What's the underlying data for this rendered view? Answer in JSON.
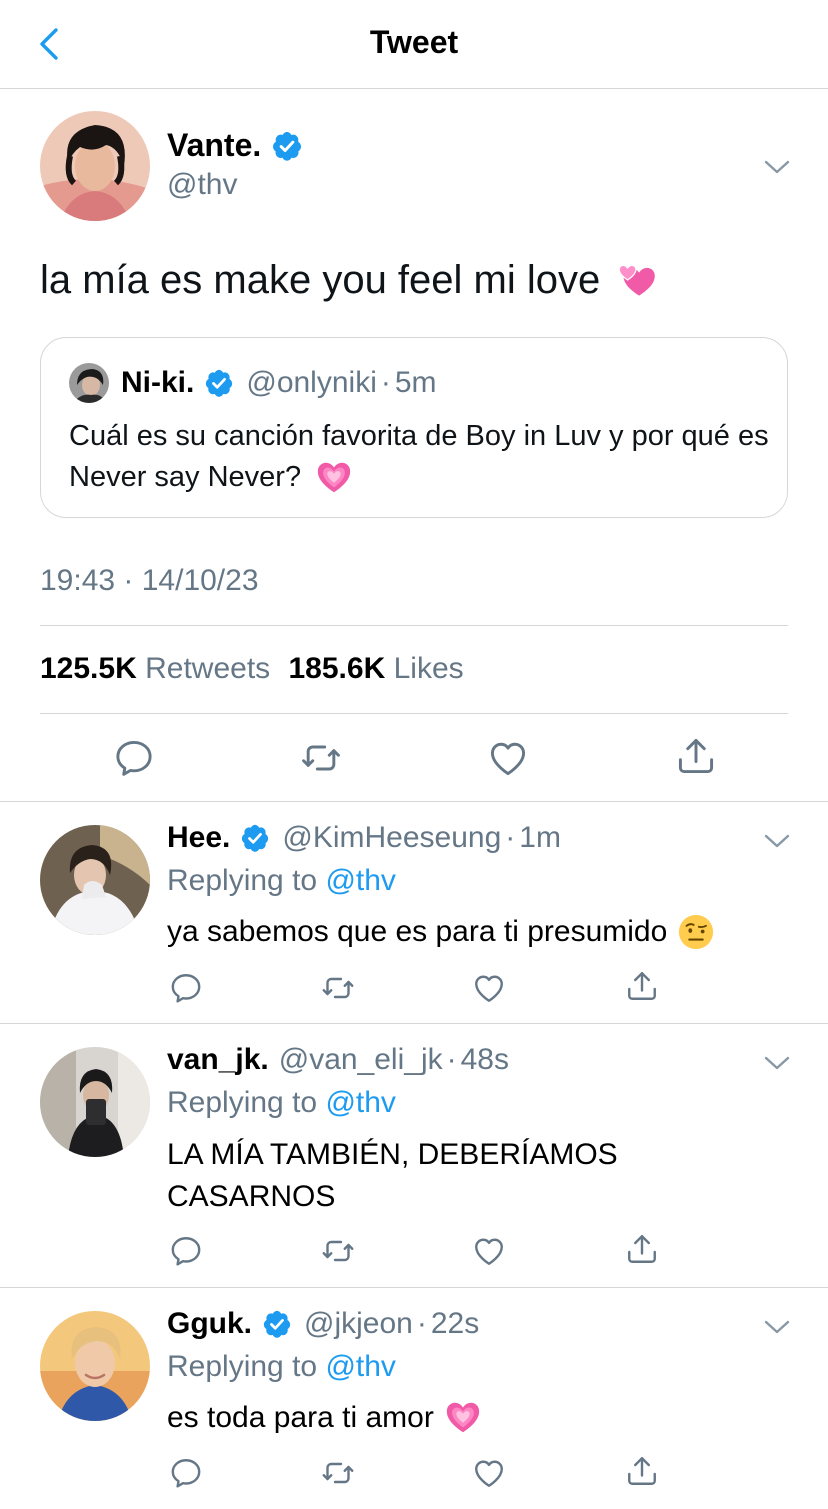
{
  "header": {
    "title": "Tweet",
    "back_icon": "chevron-left-icon",
    "accent": "#1d9bf0"
  },
  "tweet": {
    "author_name": "Vante.",
    "author_handle": "@thv",
    "verified": true,
    "text": "la mía es make you feel mi love",
    "emoji": "revolving-hearts-emoji",
    "quote": {
      "author_name": "Ni-ki.",
      "author_handle": "@onlyniki",
      "time": "5m",
      "verified": true,
      "text": "Cuál es su canción favorita de Boy in Luv y por qué es Never say Never?",
      "emoji": "growing-heart-emoji"
    },
    "timestamp": "19:43 · 14/10/23",
    "retweets_count": "125.5K",
    "retweets_label": "Retweets",
    "likes_count": "185.6K",
    "likes_label": "Likes"
  },
  "replies": [
    {
      "name": "Hee.",
      "handle": "@KimHeeseung",
      "time": "1m",
      "verified": true,
      "replying_label": "Replying to",
      "replying_to": "@thv",
      "text": "ya sabemos que es para ti presumido",
      "emoji": "face-with-raised-eyebrow-emoji"
    },
    {
      "name": "van_jk.",
      "handle": "@van_eli_jk",
      "time": "48s",
      "verified": false,
      "replying_label": "Replying to",
      "replying_to": "@thv",
      "text": "LA MÍA TAMBIÉN, DEBERÍAMOS CASARNOS",
      "emoji": ""
    },
    {
      "name": "Gguk.",
      "handle": "@jkjeon",
      "time": "22s",
      "verified": true,
      "replying_label": "Replying to",
      "replying_to": "@thv",
      "text": "es toda para ti amor",
      "emoji": "growing-heart-emoji"
    }
  ],
  "sep": "·",
  "icons": [
    "reply-icon",
    "retweet-icon",
    "like-icon",
    "share-icon",
    "verified-badge-icon",
    "chevron-down-icon"
  ]
}
